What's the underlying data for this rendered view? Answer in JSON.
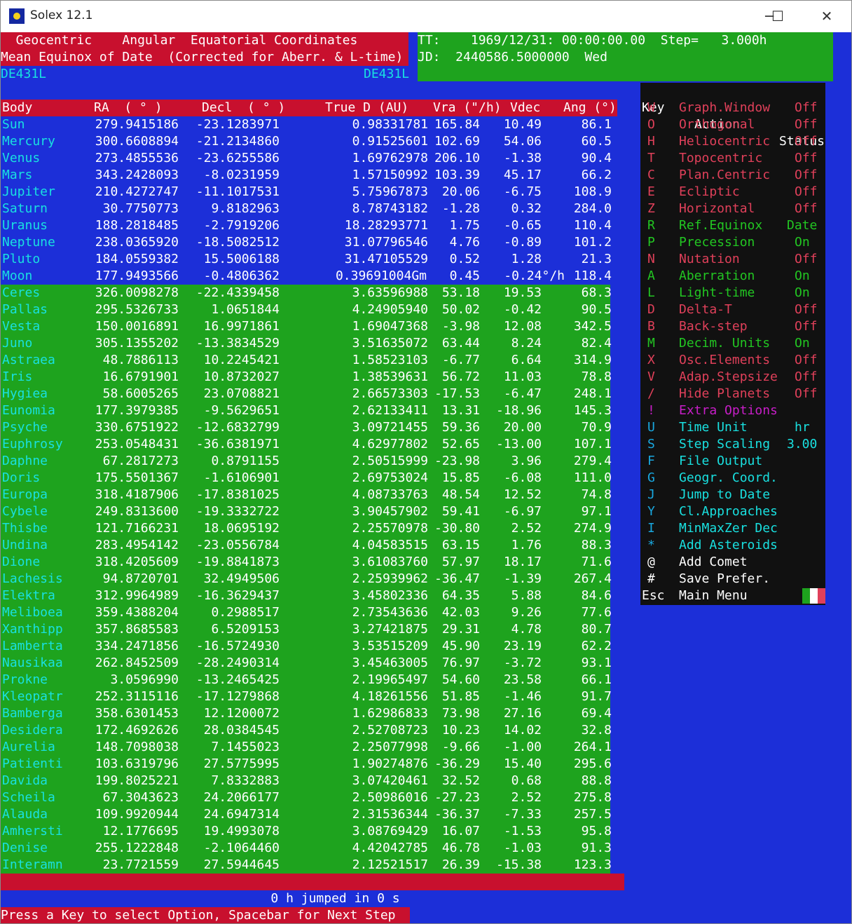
{
  "window": {
    "title": "Solex 12.1",
    "controls": [
      "─",
      "☐",
      "✕"
    ]
  },
  "header": {
    "line1": "  Geocentric    Angular  Equatorial Coordinates",
    "line2": "Mean Equinox of Date  (Corrected for Aberr. & L-time)",
    "ephem_left": "DE431L",
    "ephem_right": "DE431L",
    "time_line1": "TT:    1969/12/31: 00:00:00.00  Step=   3.000h",
    "time_line2": "JD:  2440586.5000000  Wed"
  },
  "table": {
    "columns": [
      "Body",
      "RA  ( ° )",
      "Decl  ( ° )",
      "True D (AU)",
      "Vra (\"/h)",
      "Vdec",
      "Ang (°)"
    ],
    "rows": [
      [
        "Sun",
        "279.9415186",
        "-23.1283971",
        "0.98331781",
        "165.84",
        "10.49",
        "86.1"
      ],
      [
        "Mercury",
        "300.6608894",
        "-21.2134860",
        "0.91525601",
        "102.69",
        "54.06",
        "60.5"
      ],
      [
        "Venus",
        "273.4855536",
        "-23.6255586",
        "1.69762978",
        "206.10",
        "-1.38",
        "90.4"
      ],
      [
        "Mars",
        "343.2428093",
        "-8.0231959",
        "1.57150992",
        "103.39",
        "45.17",
        "66.2"
      ],
      [
        "Jupiter",
        "210.4272747",
        "-11.1017531",
        "5.75967873",
        "20.06",
        "-6.75",
        "108.9"
      ],
      [
        "Saturn",
        "30.7750773",
        "9.8182963",
        "8.78743182",
        "-1.28",
        "0.32",
        "284.0"
      ],
      [
        "Uranus",
        "188.2818485",
        "-2.7919206",
        "18.28293771",
        "1.75",
        "-0.65",
        "110.4"
      ],
      [
        "Neptune",
        "238.0365920",
        "-18.5082512",
        "31.07796546",
        "4.76",
        "-0.89",
        "101.2"
      ],
      [
        "Pluto",
        "184.0559382",
        "15.5006188",
        "31.47105529",
        "0.52",
        "1.28",
        "21.3"
      ],
      [
        "Moon",
        "177.9493566",
        "-0.4806362",
        "0.39691004Gm",
        "0.45",
        "-0.24°/h",
        "118.4"
      ],
      [
        "Ceres",
        "326.0098278",
        "-22.4339458",
        "3.63596988",
        "53.18",
        "19.53",
        "68.3"
      ],
      [
        "Pallas",
        "295.5326733",
        "1.0651844",
        "4.24905940",
        "50.02",
        "-0.42",
        "90.5"
      ],
      [
        "Vesta",
        "150.0016891",
        "16.9971861",
        "1.69047368",
        "-3.98",
        "12.08",
        "342.5"
      ],
      [
        "Juno",
        "305.1355202",
        "-13.3834529",
        "3.51635072",
        "63.44",
        "8.24",
        "82.4"
      ],
      [
        "Astraea",
        "48.7886113",
        "10.2245421",
        "1.58523103",
        "-6.77",
        "6.64",
        "314.9"
      ],
      [
        "Iris",
        "16.6791901",
        "10.8732027",
        "1.38539631",
        "56.72",
        "11.03",
        "78.8"
      ],
      [
        "Hygiea",
        "58.6005265",
        "23.0708821",
        "2.66573303",
        "-17.53",
        "-6.47",
        "248.1"
      ],
      [
        "Eunomia",
        "177.3979385",
        "-9.5629651",
        "2.62133411",
        "13.31",
        "-18.96",
        "145.3"
      ],
      [
        "Psyche",
        "330.6751922",
        "-12.6832799",
        "3.09721455",
        "59.36",
        "20.00",
        "70.9"
      ],
      [
        "Euphrosy",
        "253.0548431",
        "-36.6381971",
        "4.62977802",
        "52.65",
        "-13.00",
        "107.1"
      ],
      [
        "Daphne",
        "67.2817273",
        "0.8791155",
        "2.50515999",
        "-23.98",
        "3.96",
        "279.4"
      ],
      [
        "Doris",
        "175.5501367",
        "-1.6106901",
        "2.69753024",
        "15.85",
        "-6.08",
        "111.0"
      ],
      [
        "Europa",
        "318.4187906",
        "-17.8381025",
        "4.08733763",
        "48.54",
        "12.52",
        "74.8"
      ],
      [
        "Cybele",
        "249.8313600",
        "-19.3332722",
        "3.90457902",
        "59.41",
        "-6.97",
        "97.1"
      ],
      [
        "Thisbe",
        "121.7166231",
        "18.0695192",
        "2.25570978",
        "-30.80",
        "2.52",
        "274.9"
      ],
      [
        "Undina",
        "283.4954142",
        "-23.0556784",
        "4.04583515",
        "63.15",
        "1.76",
        "88.3"
      ],
      [
        "Dione",
        "318.4205609",
        "-19.8841873",
        "3.61083760",
        "57.97",
        "18.17",
        "71.6"
      ],
      [
        "Lachesis",
        "94.8720701",
        "32.4949506",
        "2.25939962",
        "-36.47",
        "-1.39",
        "267.4"
      ],
      [
        "Elektra",
        "312.9964989",
        "-16.3629437",
        "3.45802336",
        "64.35",
        "5.88",
        "84.6"
      ],
      [
        "Meliboea",
        "359.4388204",
        "0.2988517",
        "2.73543636",
        "42.03",
        "9.26",
        "77.6"
      ],
      [
        "Xanthipp",
        "357.8685583",
        "6.5209153",
        "3.27421875",
        "29.31",
        "4.78",
        "80.7"
      ],
      [
        "Lamberta",
        "334.2471856",
        "-16.5724930",
        "3.53515209",
        "45.90",
        "23.19",
        "62.2"
      ],
      [
        "Nausikaa",
        "262.8452509",
        "-28.2490314",
        "3.45463005",
        "76.97",
        "-3.72",
        "93.1"
      ],
      [
        "Prokne",
        "3.0596990",
        "-13.2465425",
        "2.19965497",
        "54.60",
        "23.58",
        "66.1"
      ],
      [
        "Kleopatr",
        "252.3115116",
        "-17.1279868",
        "4.18261556",
        "51.85",
        "-1.46",
        "91.7"
      ],
      [
        "Bamberga",
        "358.6301453",
        "12.1200072",
        "1.62986833",
        "73.98",
        "27.16",
        "69.4"
      ],
      [
        "Desidera",
        "172.4692626",
        "28.0384545",
        "2.52708723",
        "10.23",
        "14.02",
        "32.8"
      ],
      [
        "Aurelia",
        "148.7098038",
        "7.1455023",
        "2.25077998",
        "-9.66",
        "-1.00",
        "264.1"
      ],
      [
        "Patienti",
        "103.6319796",
        "27.5775995",
        "1.90274876",
        "-36.29",
        "15.40",
        "295.6"
      ],
      [
        "Davida",
        "199.8025221",
        "7.8332883",
        "3.07420461",
        "32.52",
        "0.68",
        "88.8"
      ],
      [
        "Scheila",
        "67.3043623",
        "24.2066177",
        "2.50986016",
        "-27.23",
        "2.52",
        "275.8"
      ],
      [
        "Alauda",
        "109.9920944",
        "24.6947314",
        "2.31536344",
        "-36.37",
        "-7.33",
        "257.5"
      ],
      [
        "Amhersti",
        "12.1776695",
        "19.4993078",
        "3.08769429",
        "16.07",
        "-1.53",
        "95.8"
      ],
      [
        "Denise",
        "255.1222848",
        "-2.1064460",
        "4.42042785",
        "46.78",
        "-1.03",
        "91.3"
      ],
      [
        "Interamn",
        "23.7721559",
        "27.5944645",
        "2.12521517",
        "26.39",
        "-15.38",
        "123.3"
      ]
    ]
  },
  "menu": {
    "header": {
      "key": "Key",
      "action": "Action",
      "status": "Status"
    },
    "items": [
      {
        "key": "W",
        "action": "Graph.Window",
        "status": "Off",
        "key_color": "#e0405a",
        "color": "#e0405a"
      },
      {
        "key": "O",
        "action": "Orthogonal",
        "status": "Off",
        "key_color": "#e0405a",
        "color": "#e0405a"
      },
      {
        "key": "H",
        "action": "Heliocentric",
        "status": "Off",
        "key_color": "#e0405a",
        "color": "#e0405a"
      },
      {
        "key": "T",
        "action": "Topocentric",
        "status": "Off",
        "key_color": "#e0405a",
        "color": "#e0405a"
      },
      {
        "key": "C",
        "action": "Plan.Centric",
        "status": "Off",
        "key_color": "#e0405a",
        "color": "#e0405a"
      },
      {
        "key": "E",
        "action": "Ecliptic",
        "status": "Off",
        "key_color": "#e0405a",
        "color": "#e0405a"
      },
      {
        "key": "Z",
        "action": "Horizontal",
        "status": "Off",
        "key_color": "#e0405a",
        "color": "#e0405a"
      },
      {
        "key": "R",
        "action": "Ref.Equinox",
        "status": "Date",
        "key_color": "#22c622",
        "color": "#22c622"
      },
      {
        "key": "P",
        "action": "Precession",
        "status": "On",
        "key_color": "#22c622",
        "color": "#22c622"
      },
      {
        "key": "N",
        "action": "Nutation",
        "status": "Off",
        "key_color": "#e0405a",
        "color": "#e0405a"
      },
      {
        "key": "A",
        "action": "Aberration",
        "status": "On",
        "key_color": "#22c622",
        "color": "#22c622"
      },
      {
        "key": "L",
        "action": "Light-time",
        "status": "On",
        "key_color": "#22c622",
        "color": "#22c622"
      },
      {
        "key": "D",
        "action": "Delta-T",
        "status": "Off",
        "key_color": "#e0405a",
        "color": "#e0405a"
      },
      {
        "key": "B",
        "action": "Back-step",
        "status": "Off",
        "key_color": "#e0405a",
        "color": "#e0405a"
      },
      {
        "key": "M",
        "action": "Decim. Units",
        "status": "On",
        "key_color": "#22c622",
        "color": "#22c622"
      },
      {
        "key": "X",
        "action": "Osc.Elements",
        "status": "Off",
        "key_color": "#e0405a",
        "color": "#e0405a"
      },
      {
        "key": "V",
        "action": "Adap.Stepsize",
        "status": "Off",
        "key_color": "#e0405a",
        "color": "#e0405a"
      },
      {
        "key": "/",
        "action": "Hide Planets",
        "status": "Off",
        "key_color": "#e0405a",
        "color": "#e0405a"
      },
      {
        "key": "!",
        "action": "Extra Options",
        "status": "",
        "key_color": "#c81ec8",
        "color": "#c81ec8"
      },
      {
        "key": "U",
        "action": "Time Unit",
        "status": "hr",
        "key_color": "#19a8e0",
        "color": "#19e0e0"
      },
      {
        "key": "S",
        "action": "Step Scaling",
        "status": "3.00",
        "key_color": "#19a8e0",
        "color": "#19e0e0"
      },
      {
        "key": "F",
        "action": "File Output",
        "status": "",
        "key_color": "#19a8e0",
        "color": "#19e0e0"
      },
      {
        "key": "G",
        "action": "Geogr. Coord.",
        "status": "",
        "key_color": "#19a8e0",
        "color": "#19e0e0"
      },
      {
        "key": "J",
        "action": "Jump to Date",
        "status": "",
        "key_color": "#19a8e0",
        "color": "#19e0e0"
      },
      {
        "key": "Y",
        "action": "Cl.Approaches",
        "status": "",
        "key_color": "#19a8e0",
        "color": "#19e0e0"
      },
      {
        "key": "I",
        "action": "MinMaxZer Dec",
        "status": "",
        "key_color": "#19a8e0",
        "color": "#19e0e0"
      },
      {
        "key": "*",
        "action": "Add Asteroids",
        "status": "",
        "key_color": "#19a8e0",
        "color": "#19e0e0"
      },
      {
        "key": "@",
        "action": "Add Comet",
        "status": "",
        "key_color": "#ffffff",
        "color": "#ffffff"
      },
      {
        "key": "#",
        "action": "Save Prefer.",
        "status": "",
        "key_color": "#ffffff",
        "color": "#ffffff"
      },
      {
        "key": "Esc",
        "action": "Main Menu",
        "status": "",
        "key_color": "#ffffff",
        "color": "#ffffff"
      }
    ],
    "flag_colors": [
      "#1ea31e",
      "#ffffff",
      "#e0405a"
    ]
  },
  "status": {
    "jump_message": "0 h jumped in 0 s",
    "prompt": "Press a Key to select Option, Spacebar for Next Step"
  },
  "colors": {
    "background_blue": "#1c2fd8",
    "header_red": "#c8102e",
    "panel_green": "#1ea31e",
    "body_name_cyan": "#19e0e0",
    "menu_black": "#111111"
  }
}
